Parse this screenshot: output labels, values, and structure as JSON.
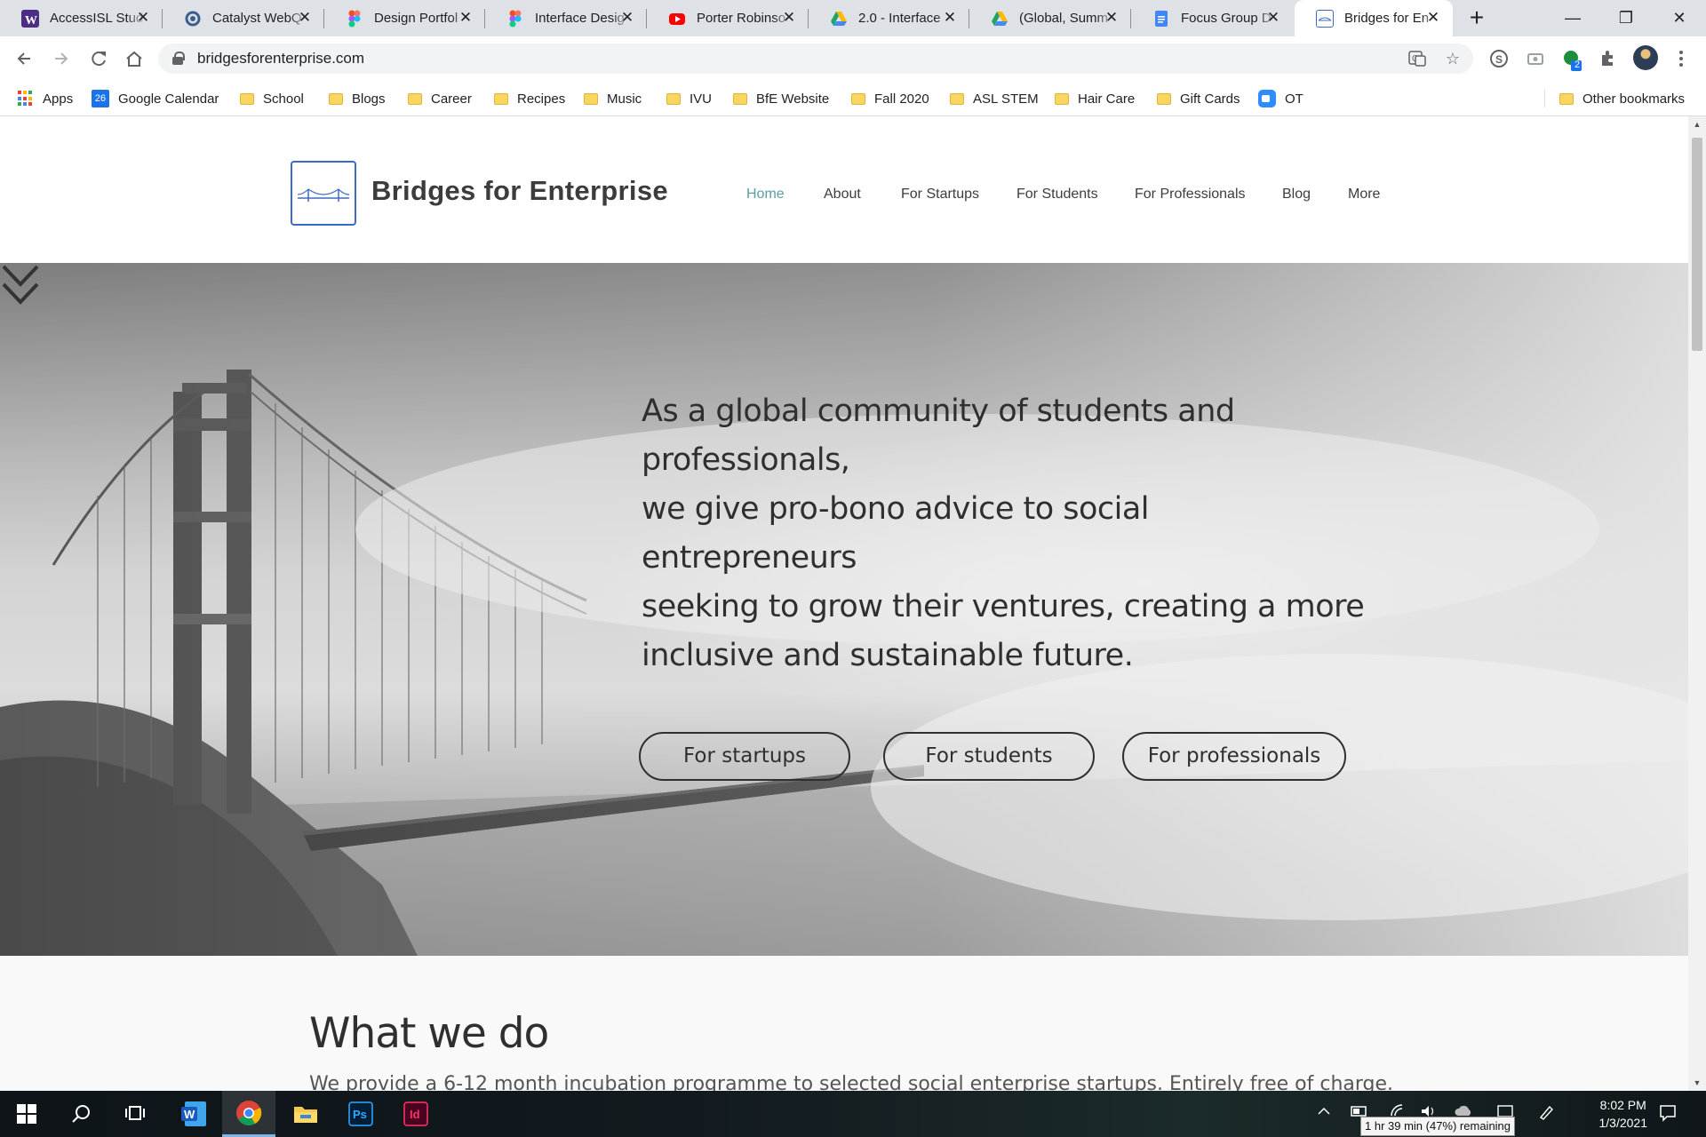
{
  "browser": {
    "tabs": [
      {
        "title": "AccessISL Stud",
        "icon": "accessisl-w-icon",
        "color": "#4b2e83"
      },
      {
        "title": "Catalyst WebQ",
        "icon": "catalyst-c-icon",
        "color": "#3a5f8f"
      },
      {
        "title": "Design Portfol",
        "icon": "figma-icon",
        "color": "#f24e1e"
      },
      {
        "title": "Interface Desig",
        "icon": "figma-icon",
        "color": "#a259ff"
      },
      {
        "title": "Porter Robinso",
        "icon": "youtube-icon",
        "color": "#ff0000"
      },
      {
        "title": "2.0 - Interface",
        "icon": "google-drive-icon",
        "color": "#1fa463"
      },
      {
        "title": "(Global, Summ",
        "icon": "google-drive-icon",
        "color": "#ffd04b"
      },
      {
        "title": "Focus Group D",
        "icon": "google-docs-icon",
        "color": "#4285f4"
      },
      {
        "title": "Bridges for En",
        "icon": "bridge-site-icon",
        "color": "#3b6bc4",
        "active": true
      }
    ],
    "new_tab_label": "+",
    "window_controls": {
      "minimize": "—",
      "restore": "❐",
      "close": "✕"
    },
    "url": "bridgesforenterprise.com",
    "extension_badge": "2"
  },
  "bookmarks": {
    "items": [
      {
        "label": "Apps",
        "type": "apps"
      },
      {
        "label": "Google Calendar",
        "type": "calendar",
        "badge": "26"
      },
      {
        "label": "School",
        "type": "folder"
      },
      {
        "label": "Blogs",
        "type": "folder"
      },
      {
        "label": "Career",
        "type": "folder"
      },
      {
        "label": "Recipes",
        "type": "folder"
      },
      {
        "label": "Music",
        "type": "folder"
      },
      {
        "label": "IVU",
        "type": "folder"
      },
      {
        "label": "BfE Website",
        "type": "folder"
      },
      {
        "label": "Fall 2020",
        "type": "folder"
      },
      {
        "label": "ASL STEM",
        "type": "folder"
      },
      {
        "label": "Hair Care",
        "type": "folder"
      },
      {
        "label": "Gift Cards",
        "type": "folder"
      },
      {
        "label": "OT",
        "type": "zoom"
      }
    ],
    "other": "Other bookmarks"
  },
  "site": {
    "brand": "Bridges for Enterprise",
    "nav": [
      "Home",
      "About",
      "For Startups",
      "For Students",
      "For Professionals",
      "Blog",
      "More"
    ],
    "nav_active": "Home",
    "accent_color": "#5a9ea6",
    "hero": {
      "lines": [
        "As a global community of students and professionals,",
        "we give pro-bono advice to social entrepreneurs",
        "seeking to grow their ventures, creating a more",
        "inclusive and sustainable future."
      ],
      "buttons": [
        "For startups",
        "For students",
        "For professionals"
      ]
    },
    "section": {
      "title": "What we do",
      "body": "We provide a 6-12 month incubation programme to selected social enterprise startups. Entirely free of charge."
    }
  },
  "taskbar": {
    "apps": [
      "windows-start-icon",
      "search-icon",
      "task-view-icon",
      "word-icon",
      "chrome-icon",
      "file-explorer-icon",
      "photoshop-icon",
      "indesign-icon"
    ],
    "time": "8:02 PM",
    "date": "1/3/2021",
    "battery_tooltip": "1 hr 39 min (47%) remaining"
  }
}
